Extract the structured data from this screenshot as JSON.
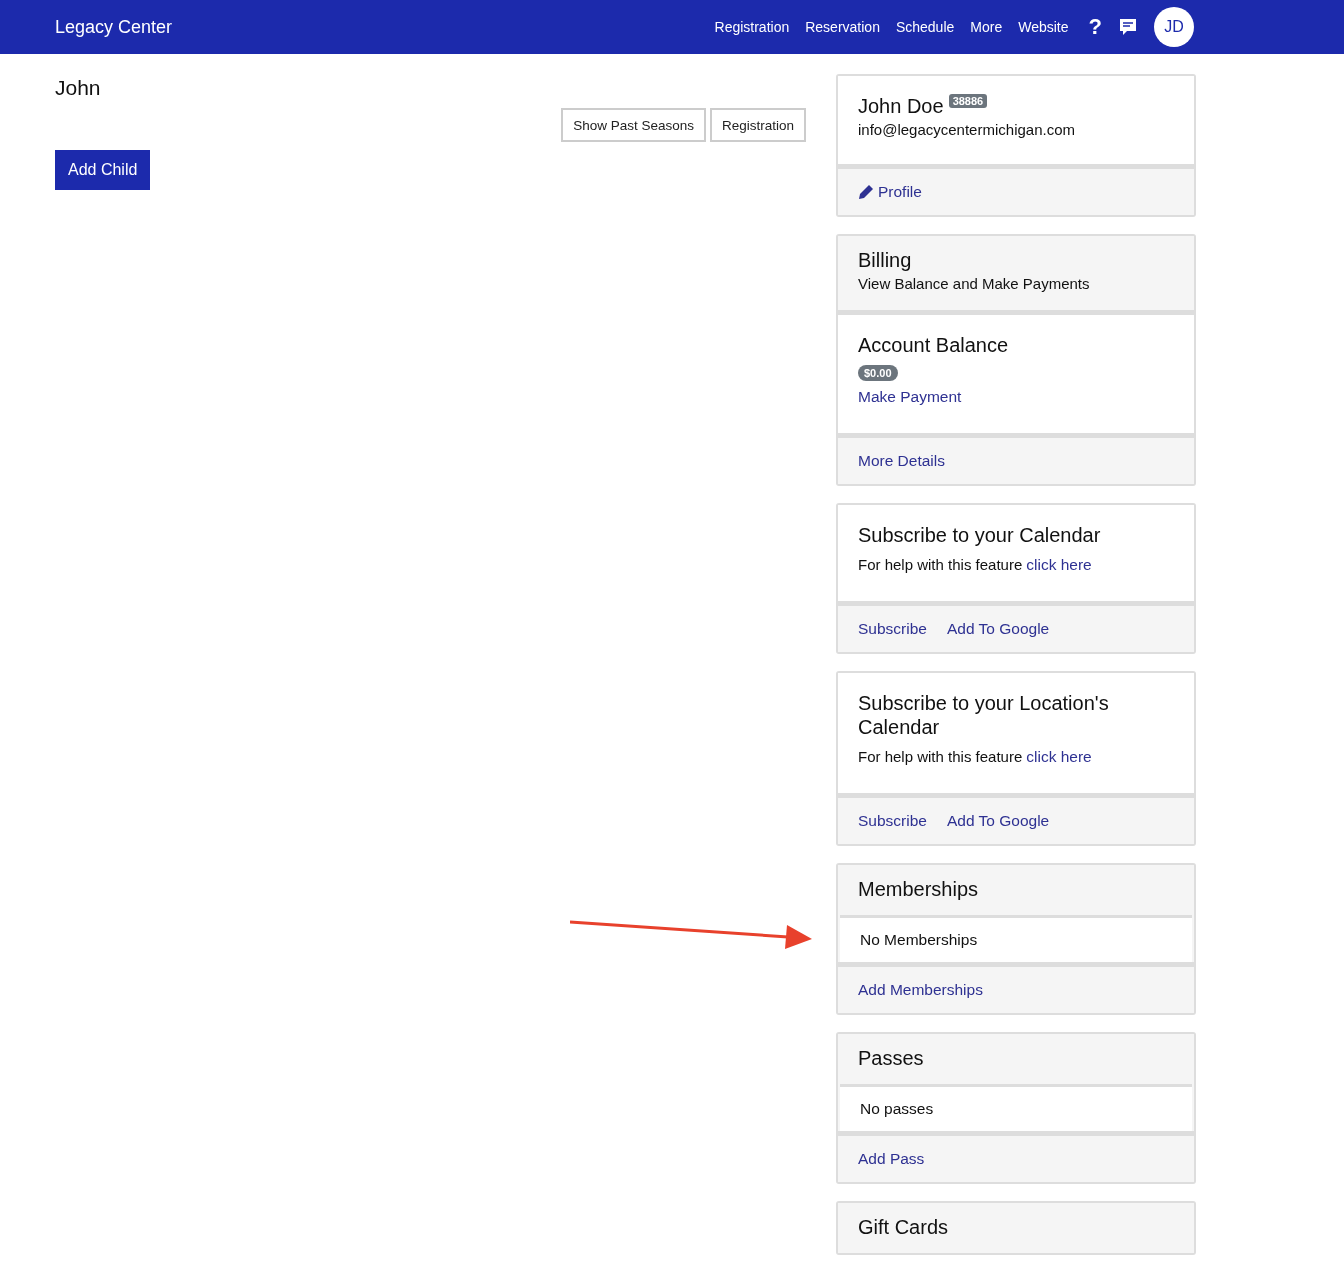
{
  "navbar": {
    "brand": "Legacy Center",
    "links": [
      "Registration",
      "Reservation",
      "Schedule",
      "More",
      "Website"
    ],
    "help": "?",
    "avatar": "JD"
  },
  "main": {
    "title": "John",
    "buttons": [
      "Show Past Seasons",
      "Registration"
    ],
    "add_button": "Add Child"
  },
  "cards": [
    {
      "parts": [
        {
          "kind": "person",
          "name": "John Doe",
          "badge": "38886",
          "email": "info@legacycentermichigan.com"
        },
        {
          "kind": "edit-link",
          "links": [
            "Profile"
          ]
        }
      ]
    },
    {
      "parts": [
        {
          "kind": "header",
          "title": "Billing",
          "subtitle": "View Balance and Make Payments"
        },
        {
          "kind": "balance",
          "title": "Account Balance",
          "amount": "$0.00",
          "link": "Make Payment"
        },
        {
          "kind": "links",
          "links": [
            "More Details"
          ]
        }
      ]
    },
    {
      "parts": [
        {
          "kind": "help",
          "title": "Subscribe to your Calendar",
          "text": "For help with this feature",
          "link": "click here"
        },
        {
          "kind": "links",
          "links": [
            "Subscribe",
            "Add To Google"
          ]
        }
      ]
    },
    {
      "parts": [
        {
          "kind": "help",
          "title": "Subscribe to your Location's Calendar",
          "text": "For help with this feature",
          "link": "click here"
        },
        {
          "kind": "links",
          "links": [
            "Subscribe",
            "Add To Google"
          ]
        }
      ]
    },
    {
      "parts": [
        {
          "kind": "header",
          "title": "Memberships"
        },
        {
          "kind": "empty",
          "text": "No Memberships"
        },
        {
          "kind": "links",
          "links": [
            "Add Memberships"
          ]
        }
      ]
    },
    {
      "parts": [
        {
          "kind": "header",
          "title": "Passes"
        },
        {
          "kind": "empty",
          "text": "No passes"
        },
        {
          "kind": "links",
          "links": [
            "Add Pass"
          ]
        }
      ]
    },
    {
      "parts": [
        {
          "kind": "header",
          "title": "Gift Cards"
        }
      ]
    }
  ]
}
